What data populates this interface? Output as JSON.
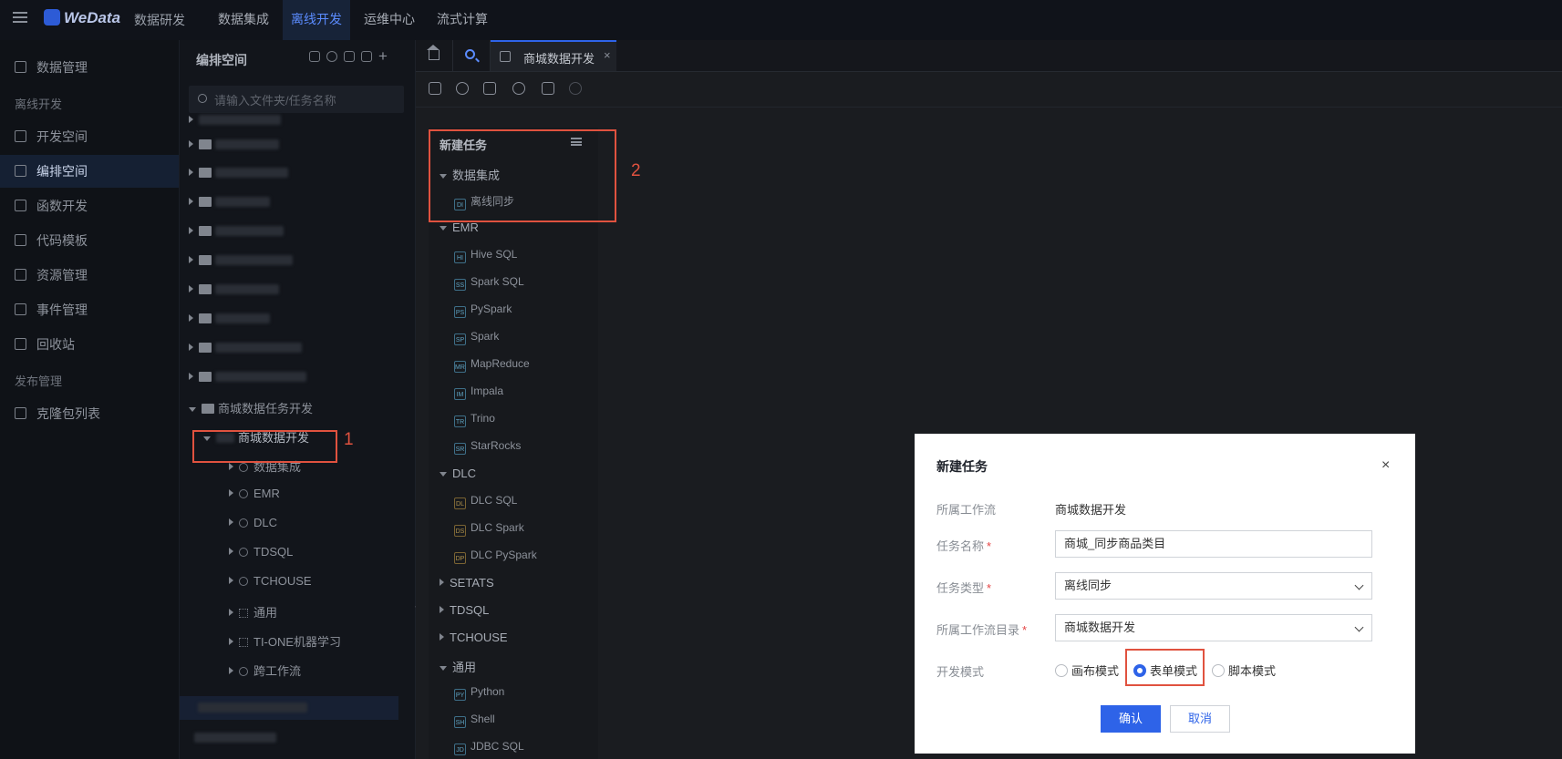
{
  "topbar": {
    "brand": "WeData",
    "module": "数据研发",
    "nav": [
      "数据集成",
      "离线开发",
      "运维中心",
      "流式计算"
    ],
    "active_nav": 1
  },
  "leftnav": {
    "items": [
      {
        "label": "数据管理",
        "icon": "database-icon"
      },
      {
        "label": "开发空间",
        "icon": "code-space-icon"
      },
      {
        "label": "编排空间",
        "icon": "orchestration-icon"
      },
      {
        "label": "函数开发",
        "icon": "function-icon"
      },
      {
        "label": "代码模板",
        "icon": "template-icon"
      },
      {
        "label": "资源管理",
        "icon": "resource-icon"
      },
      {
        "label": "事件管理",
        "icon": "event-icon"
      },
      {
        "label": "回收站",
        "icon": "trash-icon"
      },
      {
        "label": "克隆包列表",
        "icon": "clone-icon"
      }
    ],
    "sections": [
      "离线开发",
      "发布管理"
    ],
    "active_item": 2
  },
  "tree": {
    "title": "编排空间",
    "search_placeholder": "请输入文件夹/任务名称",
    "parent_folder": "商城数据任务开发",
    "workflow": "商城数据开发",
    "children": [
      "数据集成",
      "EMR",
      "DLC",
      "TDSQL",
      "TCHOUSE",
      "通用",
      "TI-ONE机器学习",
      "跨工作流"
    ]
  },
  "tabs": {
    "doc_tab": "商城数据开发",
    "close": "×"
  },
  "task_panel": {
    "title": "新建任务",
    "groups": [
      {
        "name": "数据集成",
        "items": [
          {
            "label": "离线同步",
            "badge": "DI"
          }
        ]
      },
      {
        "name": "EMR",
        "items": [
          {
            "label": "Hive SQL",
            "badge": "HI"
          },
          {
            "label": "Spark SQL",
            "badge": "SS"
          },
          {
            "label": "PySpark",
            "badge": "PS"
          },
          {
            "label": "Spark",
            "badge": "SP"
          },
          {
            "label": "MapReduce",
            "badge": "MR"
          },
          {
            "label": "Impala",
            "badge": "IM"
          },
          {
            "label": "Trino",
            "badge": "TR"
          },
          {
            "label": "StarRocks",
            "badge": "SR"
          }
        ]
      },
      {
        "name": "DLC",
        "items": [
          {
            "label": "DLC SQL",
            "badge": "DL"
          },
          {
            "label": "DLC Spark",
            "badge": "DS"
          },
          {
            "label": "DLC PySpark",
            "badge": "DP"
          }
        ]
      },
      {
        "name": "SETATS",
        "items": []
      },
      {
        "name": "TDSQL",
        "items": []
      },
      {
        "name": "TCHOUSE",
        "items": []
      },
      {
        "name": "通用",
        "items": [
          {
            "label": "Python",
            "badge": "PY"
          },
          {
            "label": "Shell",
            "badge": "SH"
          },
          {
            "label": "JDBC SQL",
            "badge": "JD"
          }
        ]
      }
    ]
  },
  "annotations": {
    "n1": "1",
    "n2": "2"
  },
  "dialog": {
    "title": "新建任务",
    "close": "×",
    "workflow_label": "所属工作流",
    "workflow_value": "商城数据开发",
    "task_name_label": "任务名称",
    "task_name_value": "商城_同步商品类目",
    "task_type_label": "任务类型",
    "task_type_value": "离线同步",
    "dir_label": "所属工作流目录",
    "dir_value": "商城数据开发",
    "mode_label": "开发模式",
    "modes": [
      "画布模式",
      "表单模式",
      "脚本模式"
    ],
    "selected_mode": 1,
    "required_mark": "*",
    "confirm": "确认",
    "cancel": "取消"
  }
}
